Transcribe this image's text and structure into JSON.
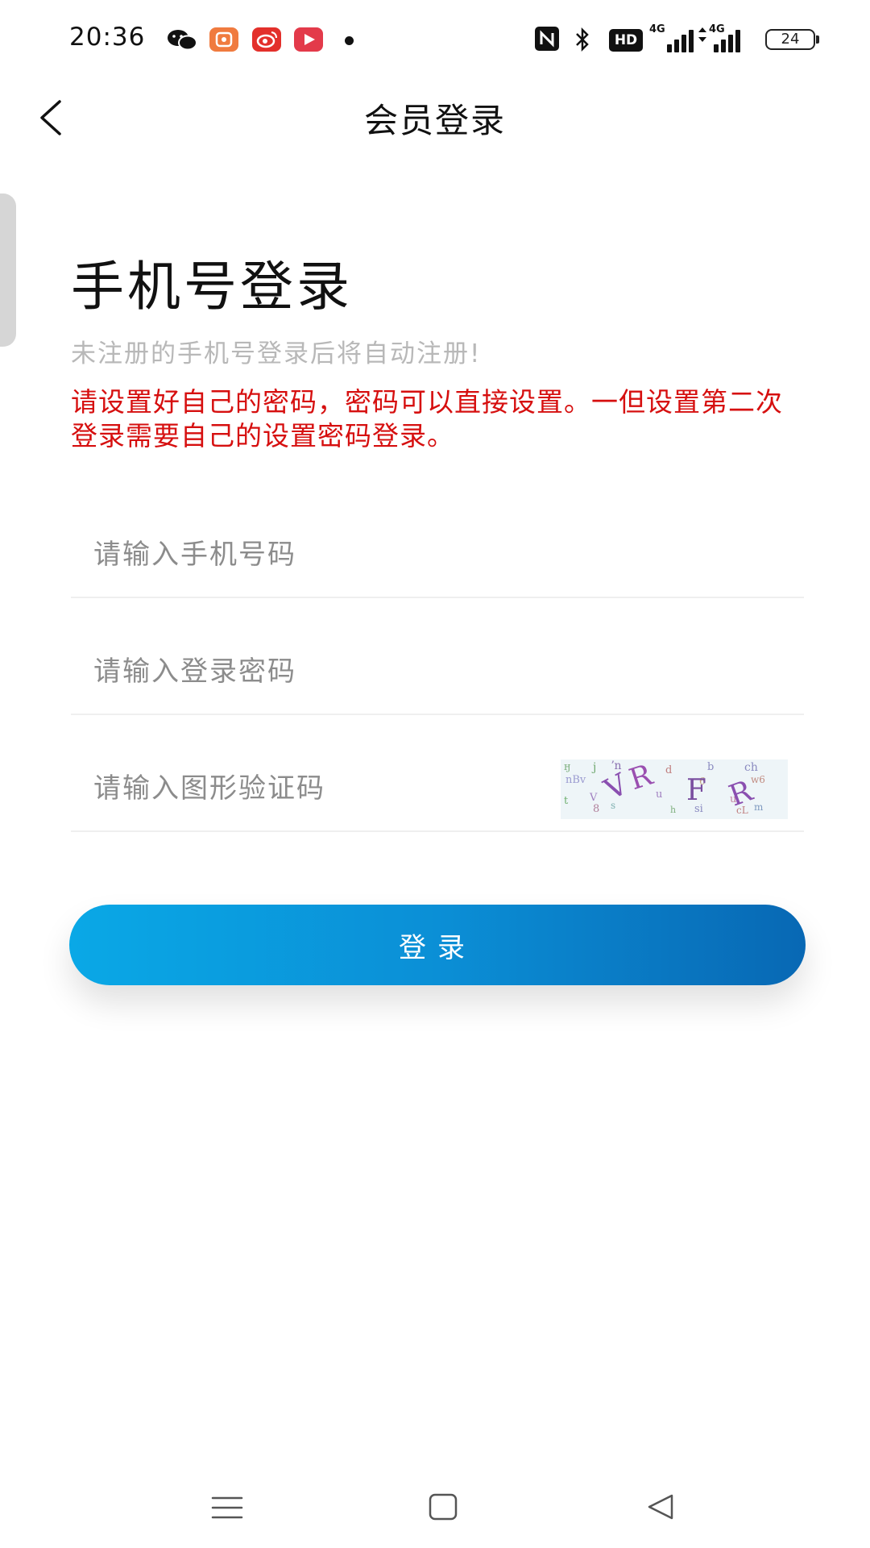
{
  "status_bar": {
    "time": "20:36",
    "hd_label": "HD",
    "signal1_label": "4G",
    "signal2_label": "4G",
    "battery": "24"
  },
  "header": {
    "title": "会员登录"
  },
  "login": {
    "title": "手机号登录",
    "subtitle": "未注册的手机号登录后将自动注册!",
    "notice": "请设置好自己的密码，密码可以直接设置。一但设置第二次登录需要自己的设置密码登录。",
    "phone_placeholder": "请输入手机号码",
    "password_placeholder": "请输入登录密码",
    "captcha_placeholder": "请输入图形验证码",
    "captcha_text": "VRFR",
    "button_label": "登录"
  },
  "colors": {
    "notice": "#d60f0f",
    "button_start": "#0aa8e6",
    "button_end": "#0868b4",
    "subtitle": "#b8b8b8"
  }
}
